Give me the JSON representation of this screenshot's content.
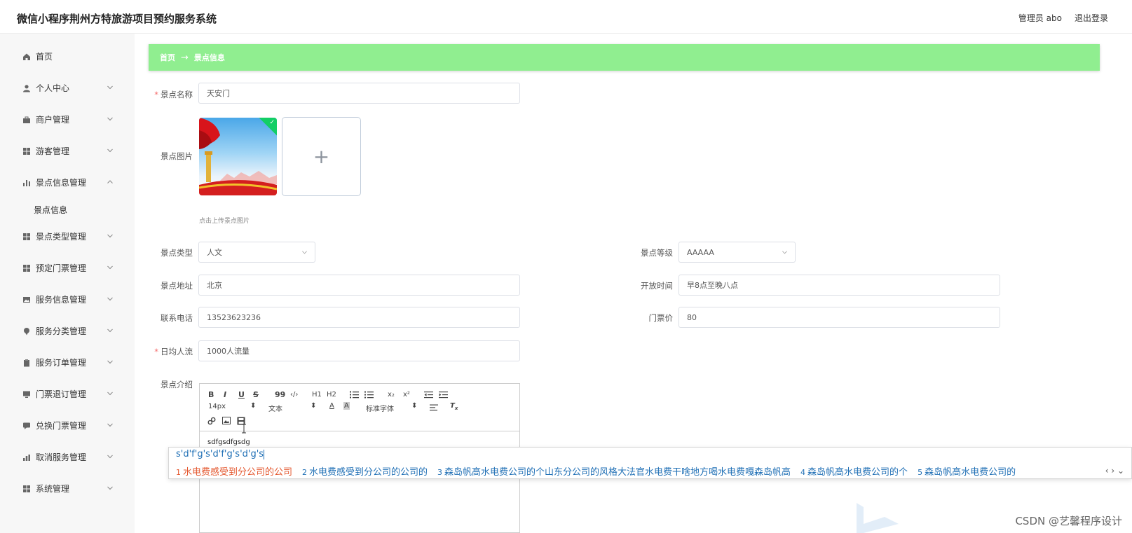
{
  "header": {
    "title": "微信小程序荆州方特旅游项目预约服务系统",
    "user_label": "管理员 abo",
    "logout_label": "退出登录"
  },
  "sidebar": {
    "items": [
      {
        "label": "首页",
        "icon": "home-icon"
      },
      {
        "label": "个人中心",
        "icon": "user-icon"
      },
      {
        "label": "商户管理",
        "icon": "briefcase-icon"
      },
      {
        "label": "游客管理",
        "icon": "grid-icon"
      },
      {
        "label": "景点信息管理",
        "icon": "bar-chart-icon"
      },
      {
        "label": "景点信息",
        "icon": ""
      },
      {
        "label": "景点类型管理",
        "icon": "grid-icon"
      },
      {
        "label": "预定门票管理",
        "icon": "grid-icon"
      },
      {
        "label": "服务信息管理",
        "icon": "image-icon"
      },
      {
        "label": "服务分类管理",
        "icon": "map-pin-icon"
      },
      {
        "label": "服务订单管理",
        "icon": "clipboard-icon"
      },
      {
        "label": "门票退订管理",
        "icon": "monitor-icon"
      },
      {
        "label": "兑换门票管理",
        "icon": "chat-icon"
      },
      {
        "label": "取消服务管理",
        "icon": "chart-icon"
      },
      {
        "label": "系统管理",
        "icon": "grid-icon"
      }
    ]
  },
  "breadcrumb": {
    "home": "首页",
    "arrow": "→",
    "current": "景点信息"
  },
  "form": {
    "name": {
      "label": "景点名称",
      "value": "天安门",
      "required": "*"
    },
    "image": {
      "label": "景点图片",
      "hint": "点击上传景点图片",
      "add": "+"
    },
    "type": {
      "label": "景点类型",
      "value": "人文"
    },
    "level": {
      "label": "景点等级",
      "value": "AAAAA"
    },
    "address": {
      "label": "景点地址",
      "value": "北京"
    },
    "open_time": {
      "label": "开放时间",
      "value": "早8点至晚八点"
    },
    "phone": {
      "label": "联系电话",
      "value": "13523623236"
    },
    "price": {
      "label": "门票价",
      "value": "80"
    },
    "visitors": {
      "label": "日均人流",
      "value": "1000人流量",
      "required": "*"
    },
    "intro": {
      "label": "景点介绍",
      "content": "sdfgsdfgsdg"
    }
  },
  "editor_toolbar": {
    "bold": "B",
    "italic": "I",
    "underline": "U",
    "strike": "S",
    "quote": "99",
    "code": "‹/›",
    "h1": "H1",
    "h2": "H2",
    "sub": "x₂",
    "sup": "x²",
    "size": "14px",
    "heading": "文本",
    "font": "标准字体"
  },
  "ime": {
    "composition": "s'd'f'g's'd'f'g's'd'g's",
    "candidates": [
      {
        "num": "1",
        "text": "水电费感受到分公司的公司"
      },
      {
        "num": "2",
        "text": "水电费感受到分公司的公司的"
      },
      {
        "num": "3",
        "text": "森岛帆高水电费公司的个山东分公司的风格大法官水电费干啥地方喝水电费嘎森岛帆高"
      },
      {
        "num": "4",
        "text": "森岛帆高水电费公司的个"
      },
      {
        "num": "5",
        "text": "森岛帆高水电费公司的"
      }
    ],
    "nav": "‹ › ⌄"
  },
  "watermark": "CSDN @艺馨程序设计"
}
